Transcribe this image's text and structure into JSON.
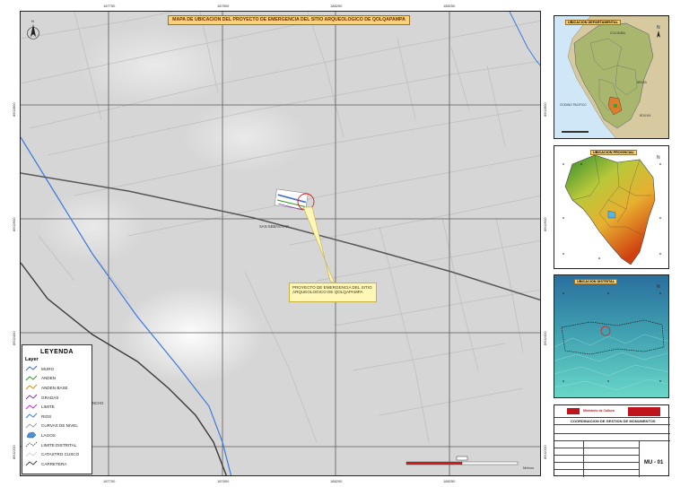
{
  "map_title": "MAPA DE UBICACION DEL PROYECTO DE EMERGENCIA DEL SITIO ARQUEOLOGICO DE QOLQAPAMPA",
  "road_labels": {
    "san_sebastian": "SAN SEBASTIAN",
    "partial_left": "NCHO"
  },
  "callout": {
    "line1": "PROYECTO DE EMERGENCIA DEL SITIO",
    "line2": "ARQUEOLOGICO  DE QOLQAPAMPA"
  },
  "legend": {
    "title": "LEYENDA",
    "subtitle": "Layer",
    "items": [
      {
        "label": "MURO",
        "color": "#3a64d8",
        "kind": "line"
      },
      {
        "label": "ANDEN",
        "color": "#2a9a2a",
        "kind": "line"
      },
      {
        "label": "ANDEN BASE",
        "color": "#e08a20",
        "kind": "line"
      },
      {
        "label": "GRADAS",
        "color": "#7a3aa0",
        "kind": "line"
      },
      {
        "label": "LIMITE",
        "color": "#d02ad0",
        "kind": "line"
      },
      {
        "label": "RIOS",
        "color": "#3a7ae0",
        "kind": "line"
      },
      {
        "label": "CURVAS DE NIVEL",
        "color": "#a0a0a0",
        "kind": "line"
      },
      {
        "label": "LAGOS",
        "color": "#4a90d8",
        "kind": "fill"
      },
      {
        "label": "LIMITE DISTRITAL",
        "color": "#555555",
        "kind": "dash"
      },
      {
        "label": "CATASTRO CUSCO",
        "color": "#bbbbbb",
        "kind": "thin"
      },
      {
        "label": "CARRETERA",
        "color": "#444444",
        "kind": "line"
      }
    ]
  },
  "grid_ticks": {
    "top": [
      "187750",
      "187800",
      "188200",
      "188250"
    ],
    "left": [
      "8502800",
      "8502600",
      "8502400",
      "8502200"
    ]
  },
  "insets": {
    "national": "UBICACION DEPARTAMENTAL",
    "provincial": "UBICACION PROVINCIAL",
    "district": "UBICACION DISTRITAL"
  },
  "title_block": {
    "entity": "Ministerio de Cultura",
    "department": "COORDINACION DE GESTION DE MONUMENTOS",
    "sheet_number": "MU - 01"
  },
  "scale_units": "Metros"
}
